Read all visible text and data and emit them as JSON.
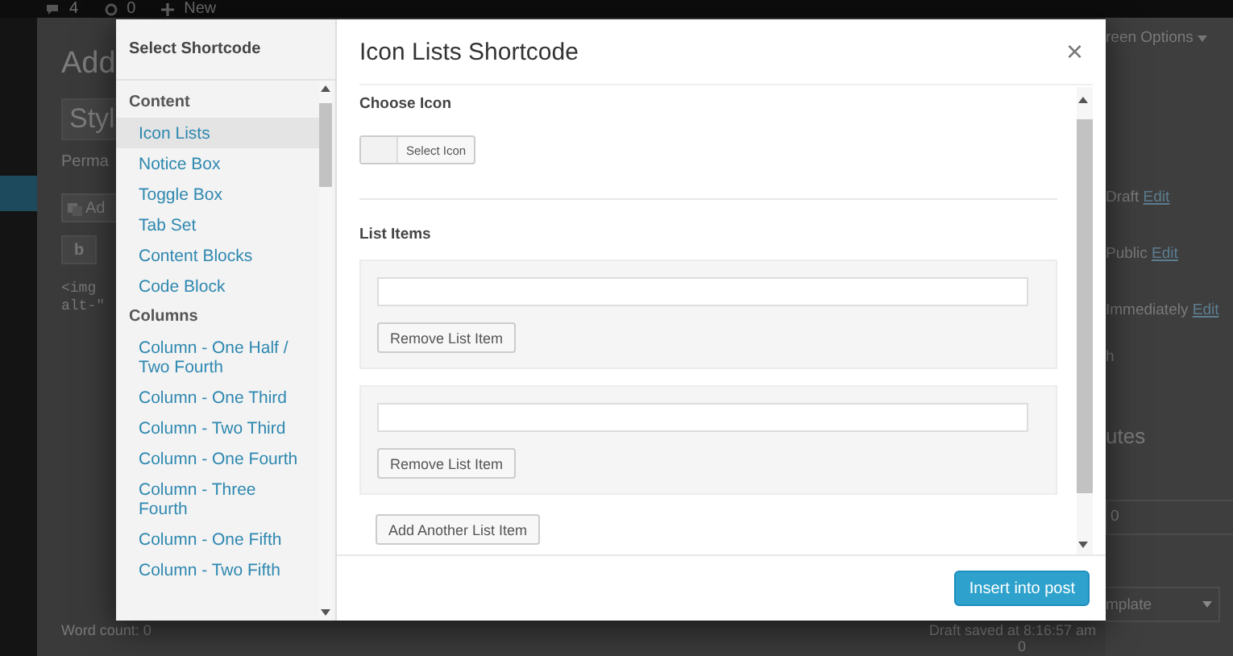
{
  "admin_bar": {
    "comments": "4",
    "updates": "0",
    "new": "New"
  },
  "editor": {
    "title": "Add",
    "post_title": "Styl",
    "permalink": "Perma",
    "add_media": "Ad",
    "toolbar_button": "b",
    "code": [
      "<img",
      "alt-\""
    ],
    "word_count": "Word count: 0",
    "draft_saved": "Draft saved at 8:16:57 am",
    "footer_number": "0"
  },
  "side_panel": {
    "screen_options": "reen Options",
    "status_rows": [
      {
        "label": "Draft",
        "link": "Edit"
      },
      {
        "label": "Public",
        "link": "Edit"
      },
      {
        "label": "Immediately",
        "link": "Edit"
      }
    ],
    "publish_fragment": "h",
    "attributes_fragment": "utes",
    "order_value": "0",
    "template": "mplate"
  },
  "modal": {
    "sidebar_title": "Select Shortcode",
    "items": [
      {
        "kind": "heading",
        "label": "Content"
      },
      {
        "kind": "item",
        "label": "Icon Lists",
        "selected": true
      },
      {
        "kind": "item",
        "label": "Notice Box",
        "selected": false
      },
      {
        "kind": "item",
        "label": "Toggle Box",
        "selected": false
      },
      {
        "kind": "item",
        "label": "Tab Set",
        "selected": false
      },
      {
        "kind": "item",
        "label": "Content Blocks",
        "selected": false
      },
      {
        "kind": "item",
        "label": "Code Block",
        "selected": false
      },
      {
        "kind": "heading",
        "label": "Columns"
      },
      {
        "kind": "item",
        "label": "Column - One Half / Two Fourth",
        "selected": false
      },
      {
        "kind": "item",
        "label": "Column - One Third",
        "selected": false
      },
      {
        "kind": "item",
        "label": "Column - Two Third",
        "selected": false
      },
      {
        "kind": "item",
        "label": "Column - One Fourth",
        "selected": false
      },
      {
        "kind": "item",
        "label": "Column - Three Fourth",
        "selected": false
      },
      {
        "kind": "item",
        "label": "Column - One Fifth",
        "selected": false
      },
      {
        "kind": "item",
        "label": "Column - Two Fifth",
        "selected": false
      }
    ],
    "title": "Icon Lists Shortcode",
    "close": "×",
    "choose_icon_label": "Choose Icon",
    "select_icon_button": "Select Icon",
    "list_items_label": "List Items",
    "list_items": [
      {
        "remove_button": "Remove List Item"
      },
      {
        "remove_button": "Remove List Item"
      }
    ],
    "add_button": "Add Another List Item",
    "submit_button": "Insert into post"
  }
}
